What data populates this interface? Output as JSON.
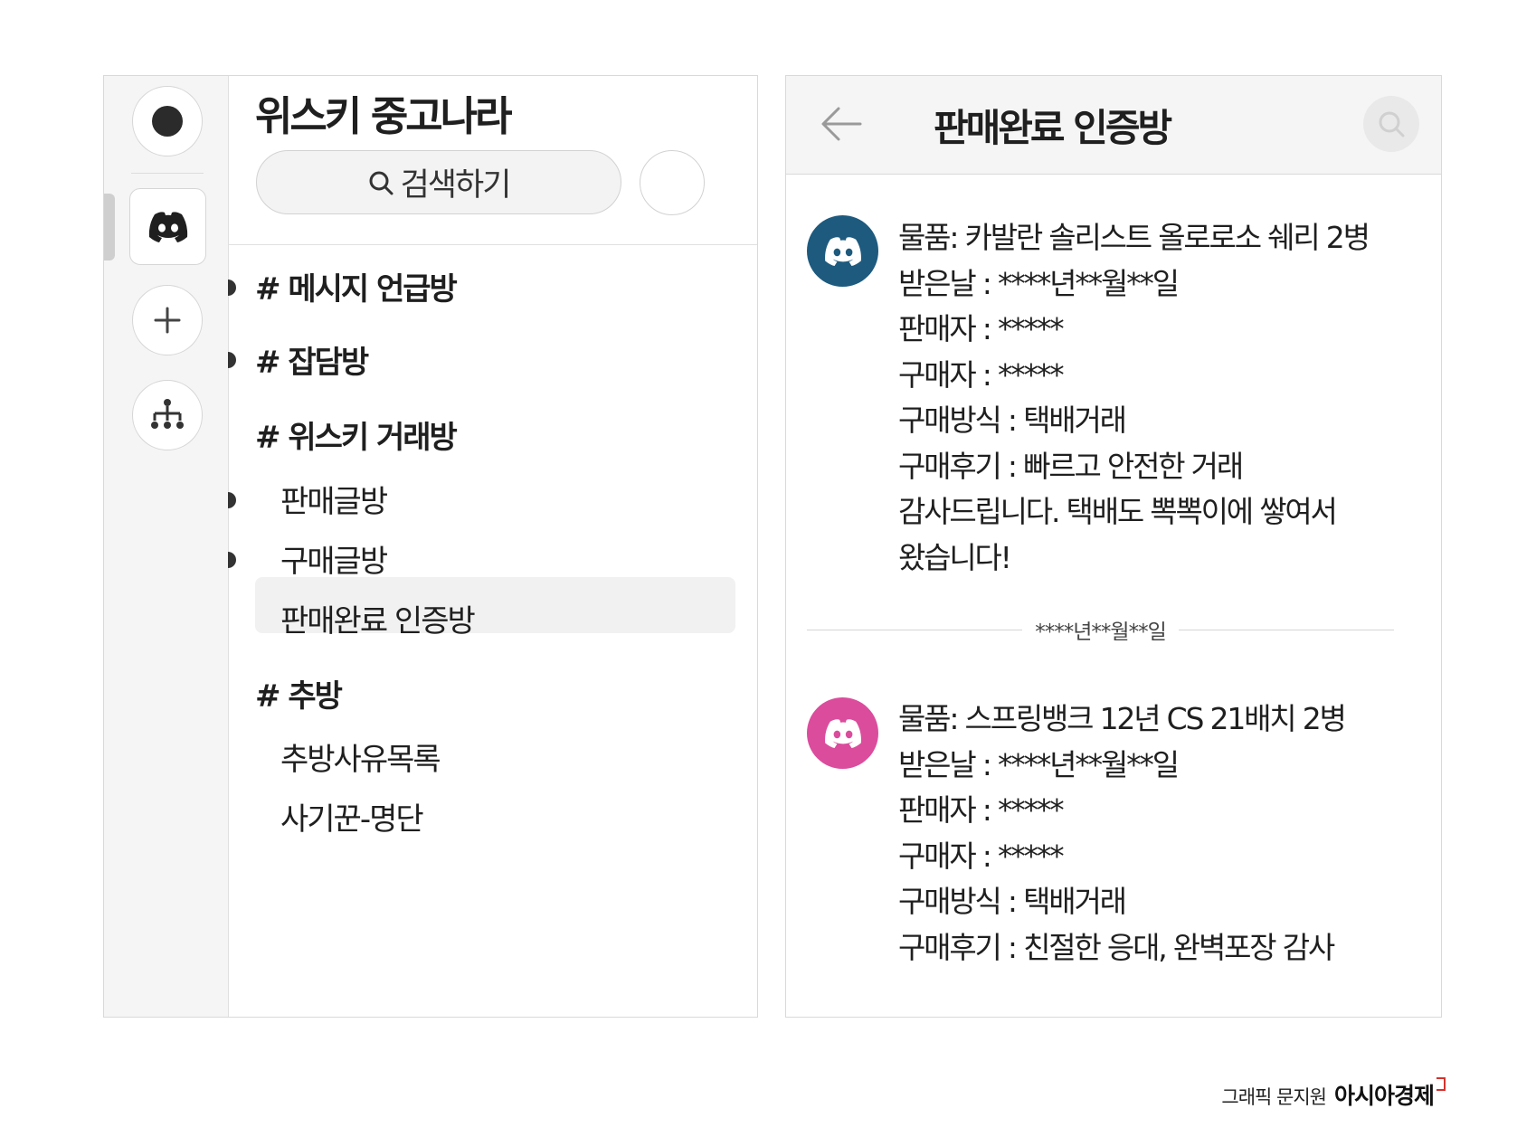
{
  "server": {
    "name": "위스키 중고나라"
  },
  "search": {
    "label": "검색하기"
  },
  "channels": [
    {
      "label": "# 메시지 언급방",
      "kind": "category",
      "unread": true
    },
    {
      "label": "# 잡담방",
      "kind": "category",
      "unread": true
    },
    {
      "label": "# 위스키 거래방",
      "kind": "category",
      "unread": false
    },
    {
      "label": "판매글방",
      "kind": "sub",
      "unread": true
    },
    {
      "label": "구매글방",
      "kind": "sub",
      "unread": true,
      "selected": true
    },
    {
      "label": "판매완료 인증방",
      "kind": "sub",
      "unread": false
    },
    {
      "label": "# 추방",
      "kind": "category",
      "unread": false
    },
    {
      "label": "추방사유목록",
      "kind": "sub",
      "unread": false
    },
    {
      "label": "사기꾼-명단",
      "kind": "sub",
      "unread": false
    }
  ],
  "chat": {
    "title": "판매완료 인증방",
    "messages": [
      {
        "avatar_color": "#1d5a7e",
        "lines": [
          "물품: 카발란 솔리스트 올로로소 쉐리 2병",
          "받은날 : ****년**월**일",
          "판매자 : *****",
          "구매자 : *****",
          "구매방식 : 택배거래",
          "구매후기 : 빠르고 안전한 거래",
          "감사드립니다. 택배도 뽁뽁이에 쌓여서",
          "왔습니다!"
        ]
      },
      {
        "avatar_color": "#db4c9d",
        "lines": [
          "물품: 스프링뱅크 12년 CS 21배치 2병",
          "받은날 : ****년**월**일",
          "판매자 : *****",
          "구매자 : *****",
          "구매방식 : 택배거래",
          "구매후기 : 친절한 응대, 완벽포장 감사"
        ]
      }
    ],
    "date_separator": "****년**월**일"
  },
  "credit": {
    "text": "그래픽 문지원",
    "brand": "아시아경제",
    "brand_color": "#d6322d"
  },
  "icons": [
    "home-dot-icon",
    "discord-icon",
    "plus-icon",
    "server-tree-icon",
    "search-icon",
    "back-arrow-icon"
  ]
}
